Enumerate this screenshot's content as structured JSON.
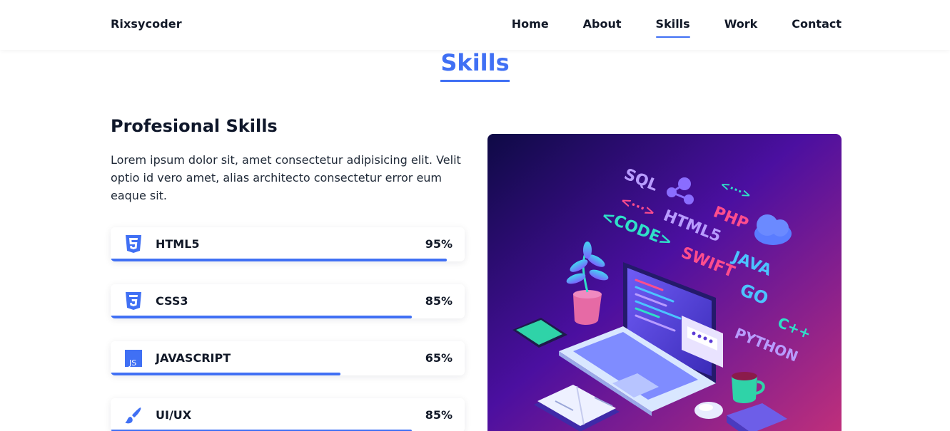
{
  "header": {
    "brand": "Rixsycoder",
    "nav": [
      {
        "label": "Home"
      },
      {
        "label": "About"
      },
      {
        "label": "Skills",
        "active": true
      },
      {
        "label": "Work"
      },
      {
        "label": "Contact"
      }
    ]
  },
  "section": {
    "title": "Skills",
    "heading": "Profesional Skills",
    "description": "Lorem ipsum dolor sit, amet consectetur adipisicing elit. Velit optio id vero amet, alias architecto consectetur error eum eaque sit."
  },
  "skills": [
    {
      "name": "HTML5",
      "percent_label": "95%",
      "percent": 95,
      "icon": "html5-icon"
    },
    {
      "name": "CSS3",
      "percent_label": "85%",
      "percent": 85,
      "icon": "css3-icon"
    },
    {
      "name": "JAVASCRIPT",
      "percent_label": "65%",
      "percent": 65,
      "icon": "javascript-icon"
    },
    {
      "name": "UI/UX",
      "percent_label": "85%",
      "percent": 85,
      "icon": "paintbrush-icon"
    }
  ],
  "illustration": {
    "words": [
      "SQL",
      "HTML5",
      "PHP",
      "<CODE>",
      "SWIFT",
      "JAVA",
      "GO",
      "PYTHON",
      "C++"
    ]
  },
  "colors": {
    "accent": "#4070f4",
    "text": "#0f172a",
    "illustration_bg_start": "#1b1464",
    "illustration_bg_end": "#b9307c"
  }
}
